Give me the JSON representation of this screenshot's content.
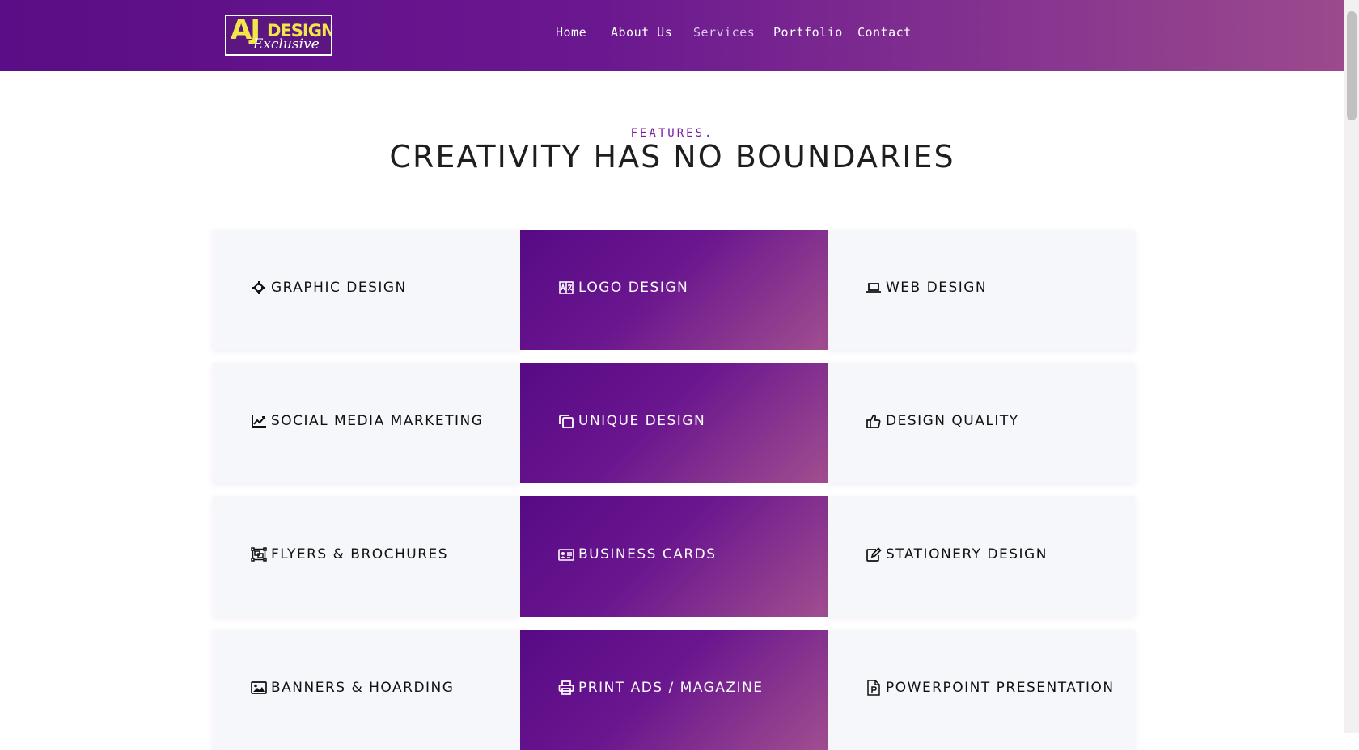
{
  "brand": {
    "logo_main": "AJ",
    "logo_word": "DESIGN",
    "logo_sub": "Exclusive"
  },
  "nav": [
    {
      "label": "Home",
      "active": false
    },
    {
      "label": "About Us",
      "active": false
    },
    {
      "label": "Services",
      "active": true
    },
    {
      "label": "Portfolio",
      "active": false
    },
    {
      "label": "Contact",
      "active": false
    }
  ],
  "section": {
    "eyebrow": "FEATURES.",
    "title": "CREATIVITY HAS NO BOUNDARIES"
  },
  "services": [
    {
      "label": "GRAPHIC DESIGN",
      "icon": "crosshair-icon",
      "style": "light"
    },
    {
      "label": "LOGO DESIGN",
      "icon": "translate-icon",
      "style": "gradient"
    },
    {
      "label": "WEB DESIGN",
      "icon": "laptop-icon",
      "style": "light"
    },
    {
      "label": "SOCIAL MEDIA MARKETING",
      "icon": "line-chart-icon",
      "style": "light"
    },
    {
      "label": "UNIQUE DESIGN",
      "icon": "copy-icon",
      "style": "gradient"
    },
    {
      "label": "DESIGN QUALITY",
      "icon": "thumbs-up-icon",
      "style": "light"
    },
    {
      "label": "FLYERS & BROCHURES",
      "icon": "object-group-icon",
      "style": "light"
    },
    {
      "label": "BUSINESS CARDS",
      "icon": "id-card-icon",
      "style": "gradient"
    },
    {
      "label": "STATIONERY DESIGN",
      "icon": "edit-icon",
      "style": "light"
    },
    {
      "label": "BANNERS & HOARDING",
      "icon": "image-icon",
      "style": "light"
    },
    {
      "label": "PRINT ADS / MAGAZINE",
      "icon": "print-icon",
      "style": "gradient"
    },
    {
      "label": "POWERPOINT PRESENTATION",
      "icon": "powerpoint-file-icon",
      "style": "light"
    }
  ],
  "colors": {
    "accent": "#6b1890",
    "accent_end": "#a14e8f",
    "card_bg": "#f6f7fb",
    "logo_yellow": "#f2e64b"
  }
}
